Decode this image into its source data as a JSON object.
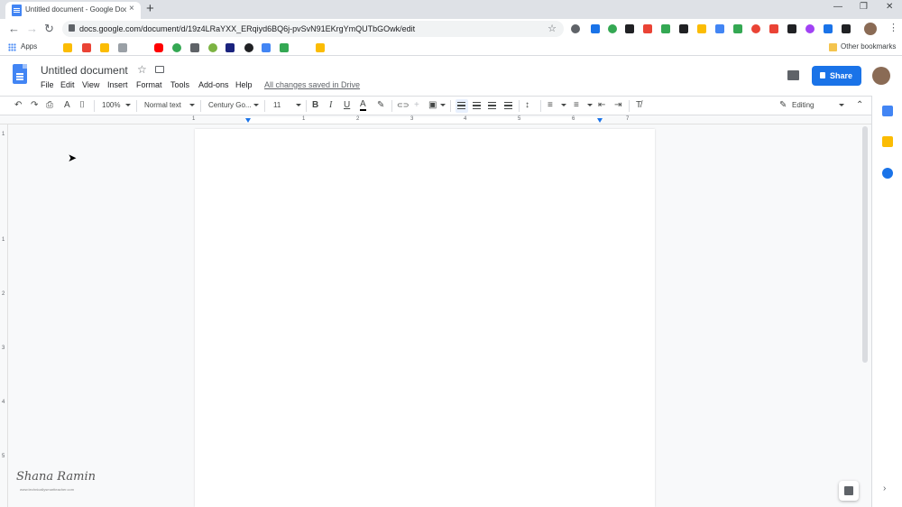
{
  "browser": {
    "tab_title": "Untitled document - Google Docs",
    "tab_close": "×",
    "new_tab": "+",
    "window_controls": [
      "—",
      "❐",
      "✕"
    ],
    "url": "docs.google.com/document/d/19z4LRaYXX_ERqiyd6BQ6j-pvSvN91EKrgYmQUTbGOwk/edit",
    "nav": {
      "back": "←",
      "forward": "→",
      "reload": "↻"
    },
    "bookmark_star": "☆",
    "menu_dots": "⋮"
  },
  "bookmarks": {
    "apps_label": "Apps",
    "other_bookmarks": "Other bookmarks"
  },
  "docs": {
    "title": "Untitled document",
    "star": "☆",
    "menu": [
      "File",
      "Edit",
      "View",
      "Insert",
      "Format",
      "Tools",
      "Add-ons",
      "Help"
    ],
    "saved_status": "All changes saved in Drive",
    "share_label": "Share"
  },
  "toolbar": {
    "undo": "↶",
    "redo": "↷",
    "print": "⎙",
    "spellcheck": "A",
    "paint_format": "⌷",
    "zoom": "100%",
    "style": "Normal text",
    "font": "Century Go...",
    "font_size": "11",
    "bold": "B",
    "italic": "I",
    "underline": "U",
    "text_color": "A",
    "highlight": "✎",
    "link": "⊂⊃",
    "comment": "+",
    "image": "▣",
    "line_spacing": "↕",
    "numbered_list": "≡",
    "bulleted_list": "≡",
    "decrease_indent": "⇤",
    "increase_indent": "⇥",
    "clear_formatting": "T̸",
    "mode": "Editing",
    "mode_icon": "✎",
    "collapse": "⌃"
  },
  "ruler": {
    "h_numbers": [
      "1",
      "1",
      "2",
      "3",
      "4",
      "5",
      "6",
      "7"
    ],
    "v_numbers": [
      "1",
      "1",
      "2",
      "3",
      "4",
      "5"
    ]
  },
  "watermark": {
    "signature": "Shana Ramin",
    "url": "www.technicallysmartteacher.com"
  },
  "side_chevron": "›",
  "colors": {
    "accent": "#1a73e8",
    "docs_blue": "#4285f4",
    "canvas": "#f8f9fa"
  }
}
